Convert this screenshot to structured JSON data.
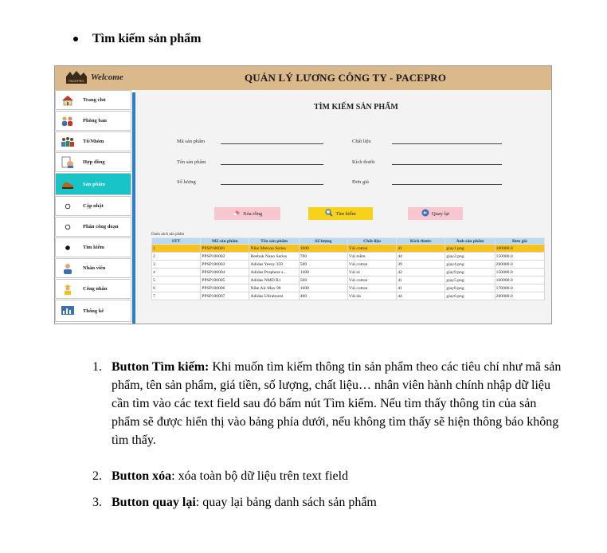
{
  "doc": {
    "heading": "Tìm kiếm sản phẩm",
    "items": [
      {
        "number": "1.",
        "bold": "Button Tìm kiếm:",
        "text": " Khi muốn tìm kiếm thông tin sản phẩm theo các tiêu chí như mã sản phẩm, tên sản phẩm, giá tiền, số lượng, chất liệu… nhân viên hành chính nhập dữ liệu cần tìm vào các text field sau đó bấm nút Tìm kiếm. Nếu tìm thấy thông tin của sản phẩm sẽ được hiển thị vào bảng phía dưới, nếu không tìm thấy sẽ hiện thông báo không tìm thấy."
      },
      {
        "number": "2.",
        "bold": "Button xóa",
        "text": ": xóa toàn bộ dữ liệu trên text field"
      },
      {
        "number": "3.",
        "bold": "Button quay lại",
        "text": ": quay lại bảng danh sách sản phẩm"
      }
    ]
  },
  "app": {
    "logo_text": "PACEPRO",
    "welcome": "Welcome",
    "title": "QUẢN LÝ LƯƠNG CÔNG TY - PACEPRO",
    "sidebar": [
      {
        "label": "Trang chủ",
        "icon": "home-icon"
      },
      {
        "label": "Phòng ban",
        "icon": "department-icon"
      },
      {
        "label": "Tổ/Nhóm",
        "icon": "group-icon"
      },
      {
        "label": "Hợp đồng",
        "icon": "contract-icon"
      },
      {
        "label": "Sản phẩm",
        "icon": "product-icon",
        "active": true
      },
      {
        "label": "Cập nhật",
        "icon": "radio-empty-icon"
      },
      {
        "label": "Phân công đoạn",
        "icon": "radio-empty-icon"
      },
      {
        "label": "Tìm kiếm",
        "icon": "radio-filled-icon"
      },
      {
        "label": "Nhân viên",
        "icon": "employee-icon"
      },
      {
        "label": "Công nhân",
        "icon": "worker-icon"
      },
      {
        "label": "Thống kê",
        "icon": "statistics-icon"
      }
    ],
    "panel_title": "TÌM KIẾM SẢN PHẨM",
    "fields": {
      "product_code": "Mã sản phẩm",
      "product_name": "Tên sản phẩm",
      "quantity": "Số lượng",
      "material": "Chất liệu",
      "size": "Kích thước",
      "unit_price": "Đơn giá"
    },
    "buttons": {
      "clear": "Xóa rỗng",
      "search": "Tìm kiếm",
      "back": "Quay lại"
    },
    "table_caption": "Danh sách sản phẩm",
    "columns": [
      "STT",
      "Mã sản phẩm",
      "Tên sản phẩm",
      "Số lượng",
      "Chất liệu",
      "Kích thước",
      "Ảnh sản phẩm",
      "Đơn giá"
    ],
    "rows": [
      [
        "1",
        "PPSP100001",
        "Nike Metcon Series",
        "1000",
        "Vải cotton",
        "41",
        "giay1.png",
        "100000.0"
      ],
      [
        "2",
        "PPSP100002",
        "Reebok Nano Series",
        "700",
        "Vải mềm",
        "44",
        "giay2.png",
        "150000.0"
      ],
      [
        "3",
        "PPSP100003",
        "Adidas Yeezy 350",
        "500",
        "Vải cotton",
        "39",
        "giay4.png",
        "200000.0"
      ],
      [
        "4",
        "PPSP100004",
        "Adidas Prophere s...",
        "1400",
        "Vải nỉ",
        "42",
        "giay9.png",
        "150000.0"
      ],
      [
        "5",
        "PPSP100005",
        "Adidas NMD R1",
        "500",
        "Vải cotton",
        "41",
        "giay5.png",
        "160000.0"
      ],
      [
        "6",
        "PPSP100006",
        "Nike Air Max 90",
        "1000",
        "Vải cotton",
        "41",
        "giay8.png",
        "170000.0"
      ],
      [
        "7",
        "PPSP100007",
        "Adidas Ultraboost",
        "400",
        "Vải da",
        "44",
        "giay6.png",
        "200000.0"
      ]
    ]
  }
}
